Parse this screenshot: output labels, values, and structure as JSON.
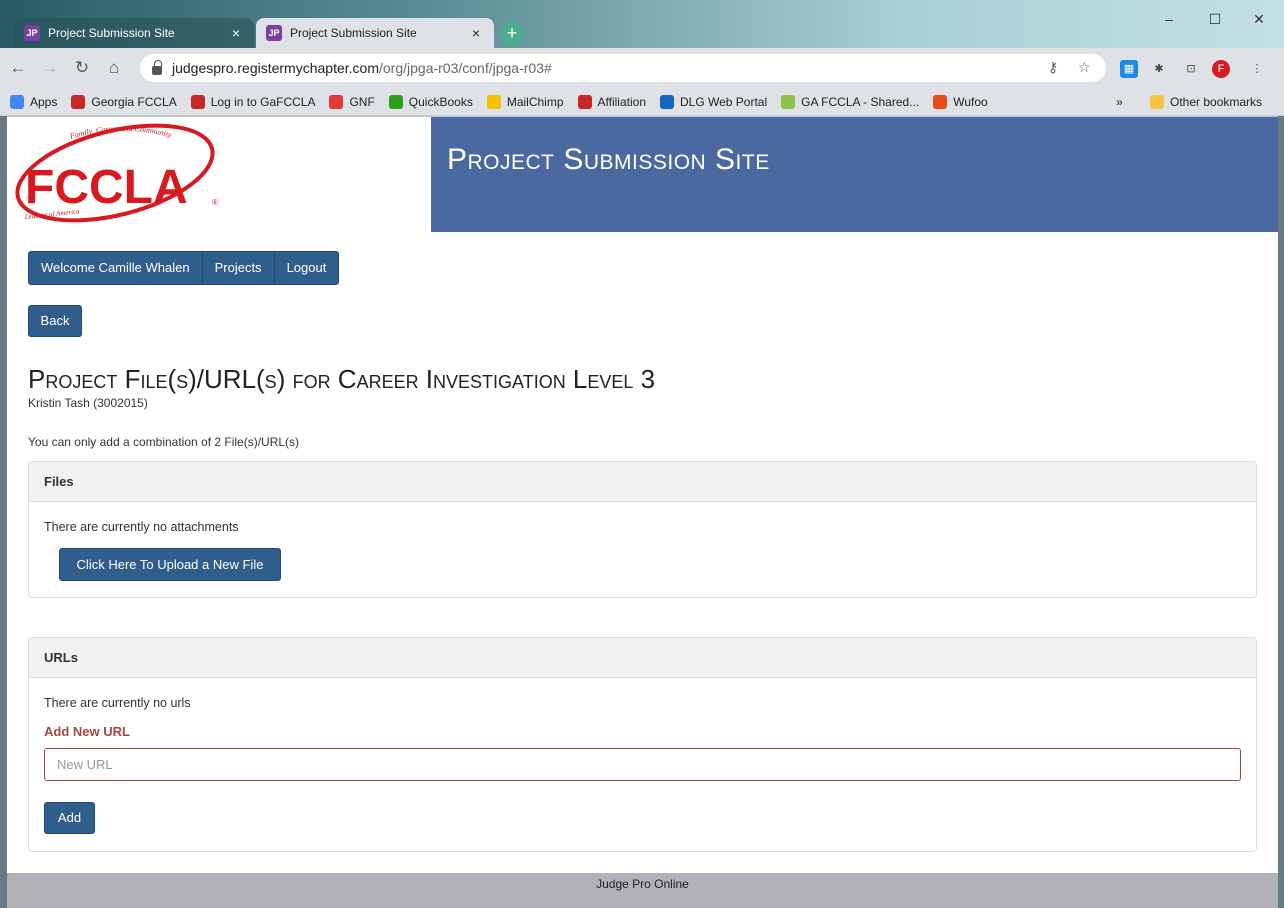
{
  "browser": {
    "tabs": [
      {
        "title": "Project Submission Site",
        "active": false
      },
      {
        "title": "Project Submission Site",
        "active": true
      }
    ],
    "close_glyph": "×",
    "new_tab_glyph": "+",
    "url_host": "judgespro.registermychapter.com",
    "url_path": "/org/jpga-r03/conf/jpga-r03#",
    "window_controls": {
      "minimize": "–",
      "maximize": "☐",
      "close": "✕"
    },
    "bookmarks": [
      {
        "label": "Apps",
        "icon": "apps-grid-icon",
        "color": "#4285f4"
      },
      {
        "label": "Georgia FCCLA",
        "icon": "fccla-icon",
        "color": "#c62828"
      },
      {
        "label": "Log in to GaFCCLA",
        "icon": "fccla-icon",
        "color": "#c62828"
      },
      {
        "label": "GNF",
        "icon": "gnf-icon",
        "color": "#e53935"
      },
      {
        "label": "QuickBooks",
        "icon": "quickbooks-icon",
        "color": "#2ca01c"
      },
      {
        "label": "MailChimp",
        "icon": "mailchimp-icon",
        "color": "#f2c200"
      },
      {
        "label": "Affiliation",
        "icon": "fccla-icon",
        "color": "#c62828"
      },
      {
        "label": "DLG Web Portal",
        "icon": "dlg-icon",
        "color": "#1565c0"
      },
      {
        "label": "GA FCCLA - Shared...",
        "icon": "drive-icon",
        "color": "#8bc34a"
      },
      {
        "label": "Wufoo",
        "icon": "wufoo-icon",
        "color": "#e64a19"
      }
    ],
    "more_bookmarks": "»",
    "other_bookmarks": "Other bookmarks"
  },
  "header": {
    "logo_text": "FCCLA",
    "logo_arc_top": "Family, Career and Community",
    "logo_arc_bottom": "Leaders of America",
    "site_title": "Project Submission Site"
  },
  "nav": {
    "welcome": "Welcome Camille Whalen",
    "projects": "Projects",
    "logout": "Logout"
  },
  "back_label": "Back",
  "page_title": "Project File(s)/URL(s) for Career Investigation Level 3",
  "student": "Kristin Tash (3002015)",
  "limit_note": "You can only add a combination of 2 File(s)/URL(s)",
  "files": {
    "heading": "Files",
    "empty_text": "There are currently no attachments",
    "upload_label": "Click Here To Upload a New File"
  },
  "urls": {
    "heading": "URLs",
    "empty_text": "There are currently no urls",
    "add_label": "Add New URL",
    "input_value": "",
    "input_placeholder": "New URL",
    "add_button": "Add"
  },
  "footer": "Judge Pro Online",
  "colors": {
    "brand_blue": "#4a69a0",
    "button_blue": "#2f5d8c",
    "error_red": "#a94442",
    "logo_red": "#d71920"
  }
}
